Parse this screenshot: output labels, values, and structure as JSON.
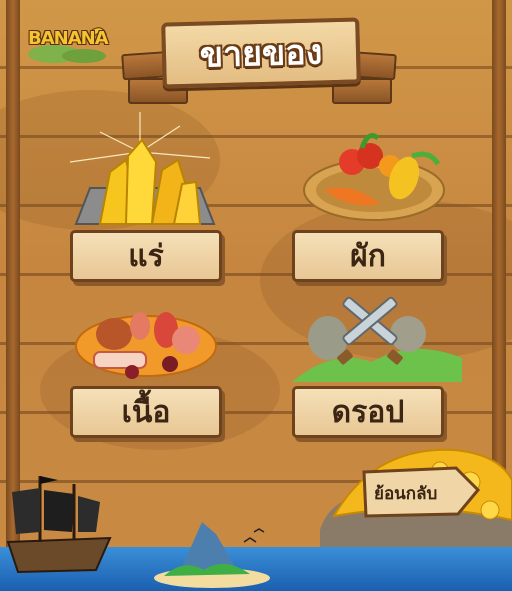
{
  "screen": {
    "title": "ขายของ",
    "logo_text": "BANANA"
  },
  "categories": [
    {
      "label": "แร่",
      "art": "ore-crystals"
    },
    {
      "label": "ผัก",
      "art": "vegetable-basket"
    },
    {
      "label": "เนื้อ",
      "art": "meat-platter"
    },
    {
      "label": "ดรอป",
      "art": "crossed-swords"
    }
  ],
  "back_button": {
    "label": "ย้อนกลับ"
  },
  "colors": {
    "wood": "#c98a3e",
    "sign": "#f0d5a6",
    "sign_border": "#6d421c",
    "text_dark": "#3b2513",
    "sea": "#2a77c6"
  }
}
